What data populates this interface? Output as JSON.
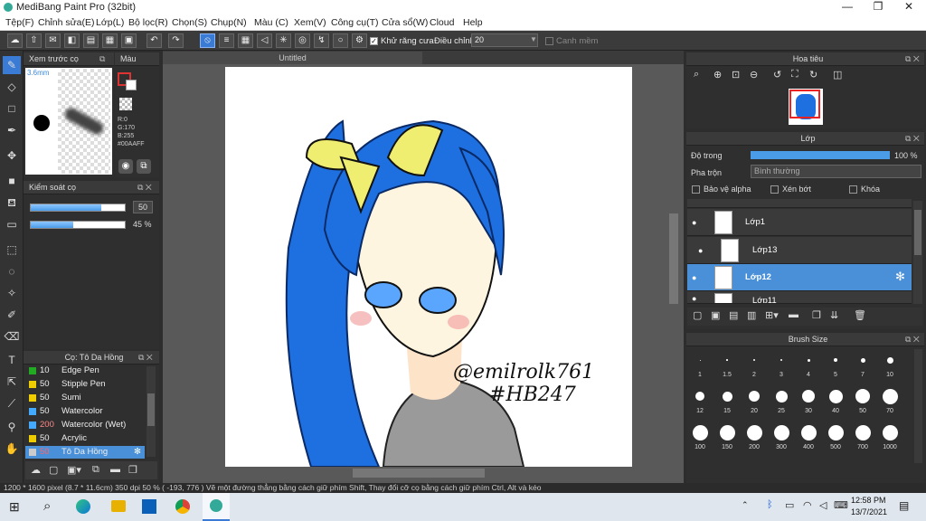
{
  "title": "MediBang Paint Pro (32bit)",
  "menu": [
    "Tệp(F)",
    "Chỉnh sửa(E)",
    "Lớp(L)",
    "Bộ lọc(R)",
    "Chọn(S)",
    "Chụp(N)",
    "Màu (C)",
    "Xem(V)",
    "Công cụ(T)",
    "Cửa sổ(W)",
    "Cloud",
    "Help"
  ],
  "toolbar": {
    "antialias": "Khử răng cưa",
    "adjust": "Điều chỉnh",
    "adjust_val": "20",
    "snap": "Canh mềm"
  },
  "preview": {
    "title": "Xem trước cọ",
    "size": "3.6mm"
  },
  "color": {
    "title": "Màu",
    "r": "R:0",
    "g": "G:170",
    "b": "B:255",
    "hex": "#00AAFF",
    "fg": "#00AAFF"
  },
  "brushctl": {
    "title": "Kiểm soát cọ",
    "v1": "50",
    "v2": "45 %"
  },
  "brushes": {
    "title": "Cọ: Tô Da Hồng",
    "items": [
      {
        "n": "10",
        "l": "Edge Pen",
        "c": "#22aa22"
      },
      {
        "n": "50",
        "l": "Stipple Pen",
        "c": "#eecc00"
      },
      {
        "n": "50",
        "l": "Sumi",
        "c": "#eecc00"
      },
      {
        "n": "50",
        "l": "Watercolor",
        "c": "#44aaff"
      },
      {
        "n": "200",
        "l": "Watercolor (Wet)",
        "c": "#44aaff"
      },
      {
        "n": "50",
        "l": "Acrylic",
        "c": "#eecc00"
      },
      {
        "n": "50",
        "l": "Tô Da Hồng",
        "c": "#cccccc"
      }
    ]
  },
  "canvas": {
    "tab": "Untitled",
    "sig1": "@emilrolk761",
    "sig2": "#HB247"
  },
  "navigator": {
    "title": "Hoa tiêu"
  },
  "layers": {
    "title": "Lớp",
    "opacity_label": "Độ trong",
    "opacity": "100 %",
    "blend_label": "Pha trộn",
    "blend": "Bình thường",
    "protect": "Bảo vệ alpha",
    "clip": "Xén bớt",
    "lock": "Khóa",
    "items": [
      {
        "name": "Lớp1"
      },
      {
        "name": "Lớp13"
      },
      {
        "name": "Lớp12"
      },
      {
        "name": "Lớp11"
      }
    ]
  },
  "brushsize": {
    "title": "Brush Size",
    "sizes": [
      "1",
      "1.5",
      "2",
      "3",
      "4",
      "5",
      "7",
      "10",
      "12",
      "15",
      "20",
      "25",
      "30",
      "40",
      "50",
      "70",
      "100",
      "150",
      "200",
      "300",
      "400",
      "500",
      "700",
      "1000"
    ]
  },
  "status": "1200 * 1600 pixel   (8.7 * 11.6cm)   350 dpi   50 %   ( -193, 776 )   Vẽ một đường thẳng bằng cách giữ phím Shift, Thay đổi cỡ cọ bằng cách giữ phím Ctrl, Alt và kéo",
  "clock": {
    "time": "12:58 PM",
    "date": "13/7/2021"
  }
}
